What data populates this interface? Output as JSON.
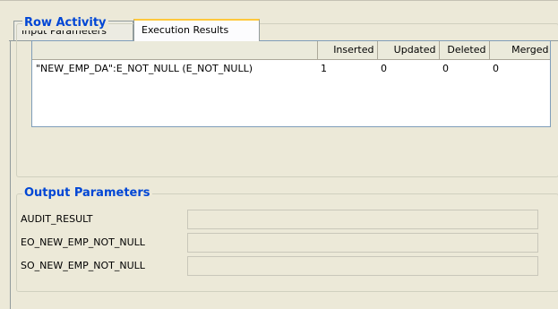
{
  "tabs": [
    {
      "label": "Input Parameters",
      "active": false
    },
    {
      "label": "Execution Results",
      "active": true
    }
  ],
  "row_activity": {
    "title": "Row Activity",
    "columns": [
      "",
      "Inserted",
      "Updated",
      "Deleted",
      "Merged"
    ],
    "rows": [
      {
        "name": "\"NEW_EMP_DA\":E_NOT_NULL (E_NOT_NULL)",
        "inserted": "1",
        "updated": "0",
        "deleted": "0",
        "merged": "0"
      }
    ]
  },
  "output_parameters": {
    "title": "Output Parameters",
    "params": [
      {
        "label": "AUDIT_RESULT",
        "value": ""
      },
      {
        "label": "EO_NEW_EMP_NOT_NULL",
        "value": ""
      },
      {
        "label": "SO_NEW_EMP_NOT_NULL",
        "value": ""
      }
    ]
  },
  "colors": {
    "window_bg": "#ece9d8",
    "group_title": "#0046d5",
    "active_tab_highlight": "#ffc83c",
    "border": "#919b9c"
  }
}
